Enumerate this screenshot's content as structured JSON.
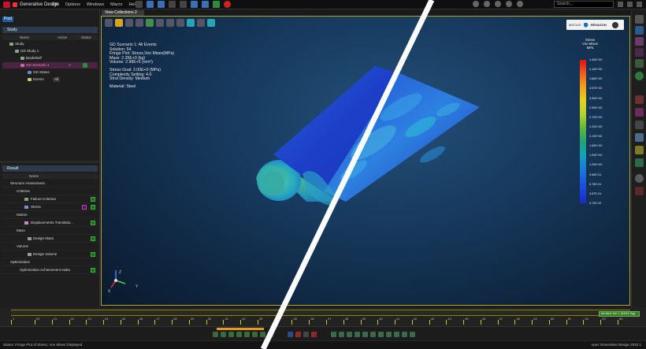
{
  "app": {
    "title": "Generative Design"
  },
  "menus": [
    "File",
    "Options",
    "Windows",
    "Macro",
    "Help"
  ],
  "search": {
    "placeholder": "Search..."
  },
  "left": {
    "post_tab": "Post",
    "study_header": "Study",
    "study_cols": {
      "name": "Name",
      "active": "Active",
      "status": "Status"
    },
    "tree": [
      {
        "label": "Study"
      },
      {
        "label": "GD Study 1"
      },
      {
        "label": "Bookshelf"
      },
      {
        "label": "GD Scenario 1"
      },
      {
        "label": "GD Status"
      },
      {
        "label": "Events",
        "value": "All"
      }
    ],
    "result_header": "Result",
    "result_col": "Name",
    "results": [
      {
        "label": "Structure Assessment"
      },
      {
        "label": "Criterion"
      },
      {
        "label": "Failure Criterion"
      },
      {
        "label": "Stress"
      },
      {
        "label": "Motion"
      },
      {
        "label": "Displacements Translatio..."
      },
      {
        "label": "Mass"
      },
      {
        "label": "Design Mass"
      },
      {
        "label": "Volume"
      },
      {
        "label": "Design Volume"
      },
      {
        "label": "Optimization"
      },
      {
        "label": "Optimization Achievement Index"
      }
    ]
  },
  "viewport": {
    "tab": "View Collections 2",
    "info": [
      "GD Scenario 1: All Events",
      "Solution: 54",
      "Fringe Plot: Stress,Von Mises(MPa)",
      "Mass: 2.35E+0 (kg)",
      "Volume: 2.99E+5 (mm³)",
      "",
      "Stress Goal: 2.00E+0 (MPa)",
      "Complexity Setting: 4.0",
      "Strut Density: Medium",
      "",
      "Material: Steel"
    ],
    "brand": {
      "left": "MSC/UX",
      "right": "HEXAGON"
    },
    "legend": {
      "title": "Stress\nVon Mises\nMPa",
      "labels": [
        "4.40E+00",
        "4.14E+00",
        "3.86E+00",
        "3.57E+00",
        "3.30E+00",
        "2.99E+00",
        "2.70E+00",
        "2.41E+00",
        "2.12E+00",
        "1.83E+00",
        "1.54E+00",
        "1.29E+00",
        "9.68E-01",
        "6.78E-01",
        "3.87E-01",
        "9.70E-02"
      ]
    },
    "triad": {
      "x": "X",
      "y": "Y",
      "z": "Z"
    }
  },
  "timeline": {
    "ticks": [
      "1",
      "20",
      "21",
      "22",
      "23",
      "24",
      "25",
      "26",
      "27",
      "28",
      "29",
      "30",
      "31",
      "32",
      "33",
      "34",
      "35",
      "36",
      "37",
      "38",
      "39",
      "40",
      "41",
      "42",
      "43",
      "44",
      "45",
      "46",
      "47",
      "48",
      "49",
      "50",
      "51",
      "52",
      "53",
      "54"
    ],
    "iteration_label": "Iteration Set 1 (54/54 Sig)"
  },
  "status": {
    "text": "Status: Fringe Plot of Stress, Von Mises Displayed",
    "right": "Apex Generative Design 2022.1"
  }
}
